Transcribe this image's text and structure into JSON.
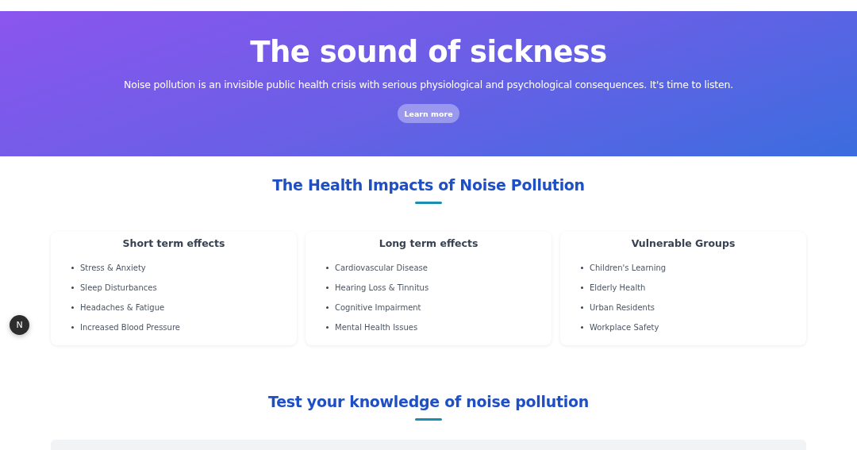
{
  "hero": {
    "title": "The sound of sickness",
    "subtitle": "Noise pollution is an invisible public health crisis with serious physiological and psychological consequences. It's time to listen.",
    "button": "Learn more"
  },
  "impacts": {
    "title": "The Health Impacts of Noise Pollution",
    "cards": [
      {
        "title": "Short term effects",
        "items": [
          "Stress & Anxiety",
          "Sleep Disturbances",
          "Headaches & Fatigue",
          "Increased Blood Pressure"
        ]
      },
      {
        "title": "Long term effects",
        "items": [
          "Cardiovascular Disease",
          "Hearing Loss & Tinnitus",
          "Cognitive Impairment",
          "Mental Health Issues"
        ]
      },
      {
        "title": "Vulnerable Groups",
        "items": [
          "Children's Learning",
          "Elderly Health",
          "Urban Residents",
          "Workplace Safety"
        ]
      }
    ]
  },
  "quiz": {
    "title": "Test your knowledge of noise pollution"
  },
  "dev_badge": {
    "label": "N"
  }
}
